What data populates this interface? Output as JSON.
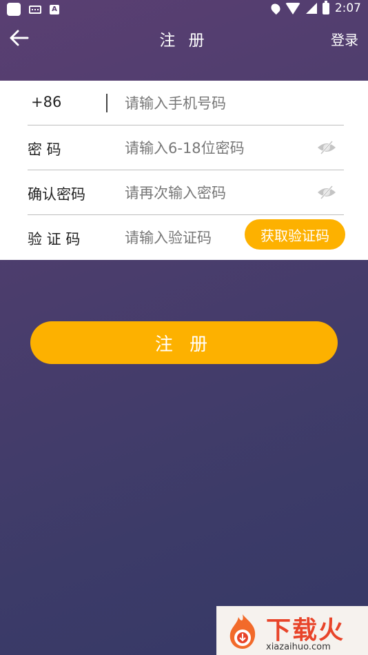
{
  "status_bar": {
    "time": "2:07",
    "icons": [
      "app-icon",
      "keyboard-icon",
      "a-icon",
      "location-icon",
      "wifi-icon",
      "signal-icon",
      "battery-icon"
    ]
  },
  "header": {
    "title": "注 册",
    "login_label": "登录"
  },
  "form": {
    "phone": {
      "country_code": "+86",
      "placeholder": "请输入手机号码"
    },
    "password": {
      "label": "密 码",
      "placeholder": "请输入6-18位密码"
    },
    "confirm": {
      "label": "确认密码",
      "placeholder": "请再次输入密码"
    },
    "code": {
      "label": "验 证 码",
      "placeholder": "请输入验证码",
      "button_label": "获取验证码"
    }
  },
  "register_button": {
    "label": "注 册"
  },
  "watermark": {
    "text": "下载火",
    "url": "xiazaihuo.com"
  },
  "colors": {
    "accent": "#fdb100",
    "background_top": "#5a3f72",
    "background_bottom": "#363866"
  }
}
